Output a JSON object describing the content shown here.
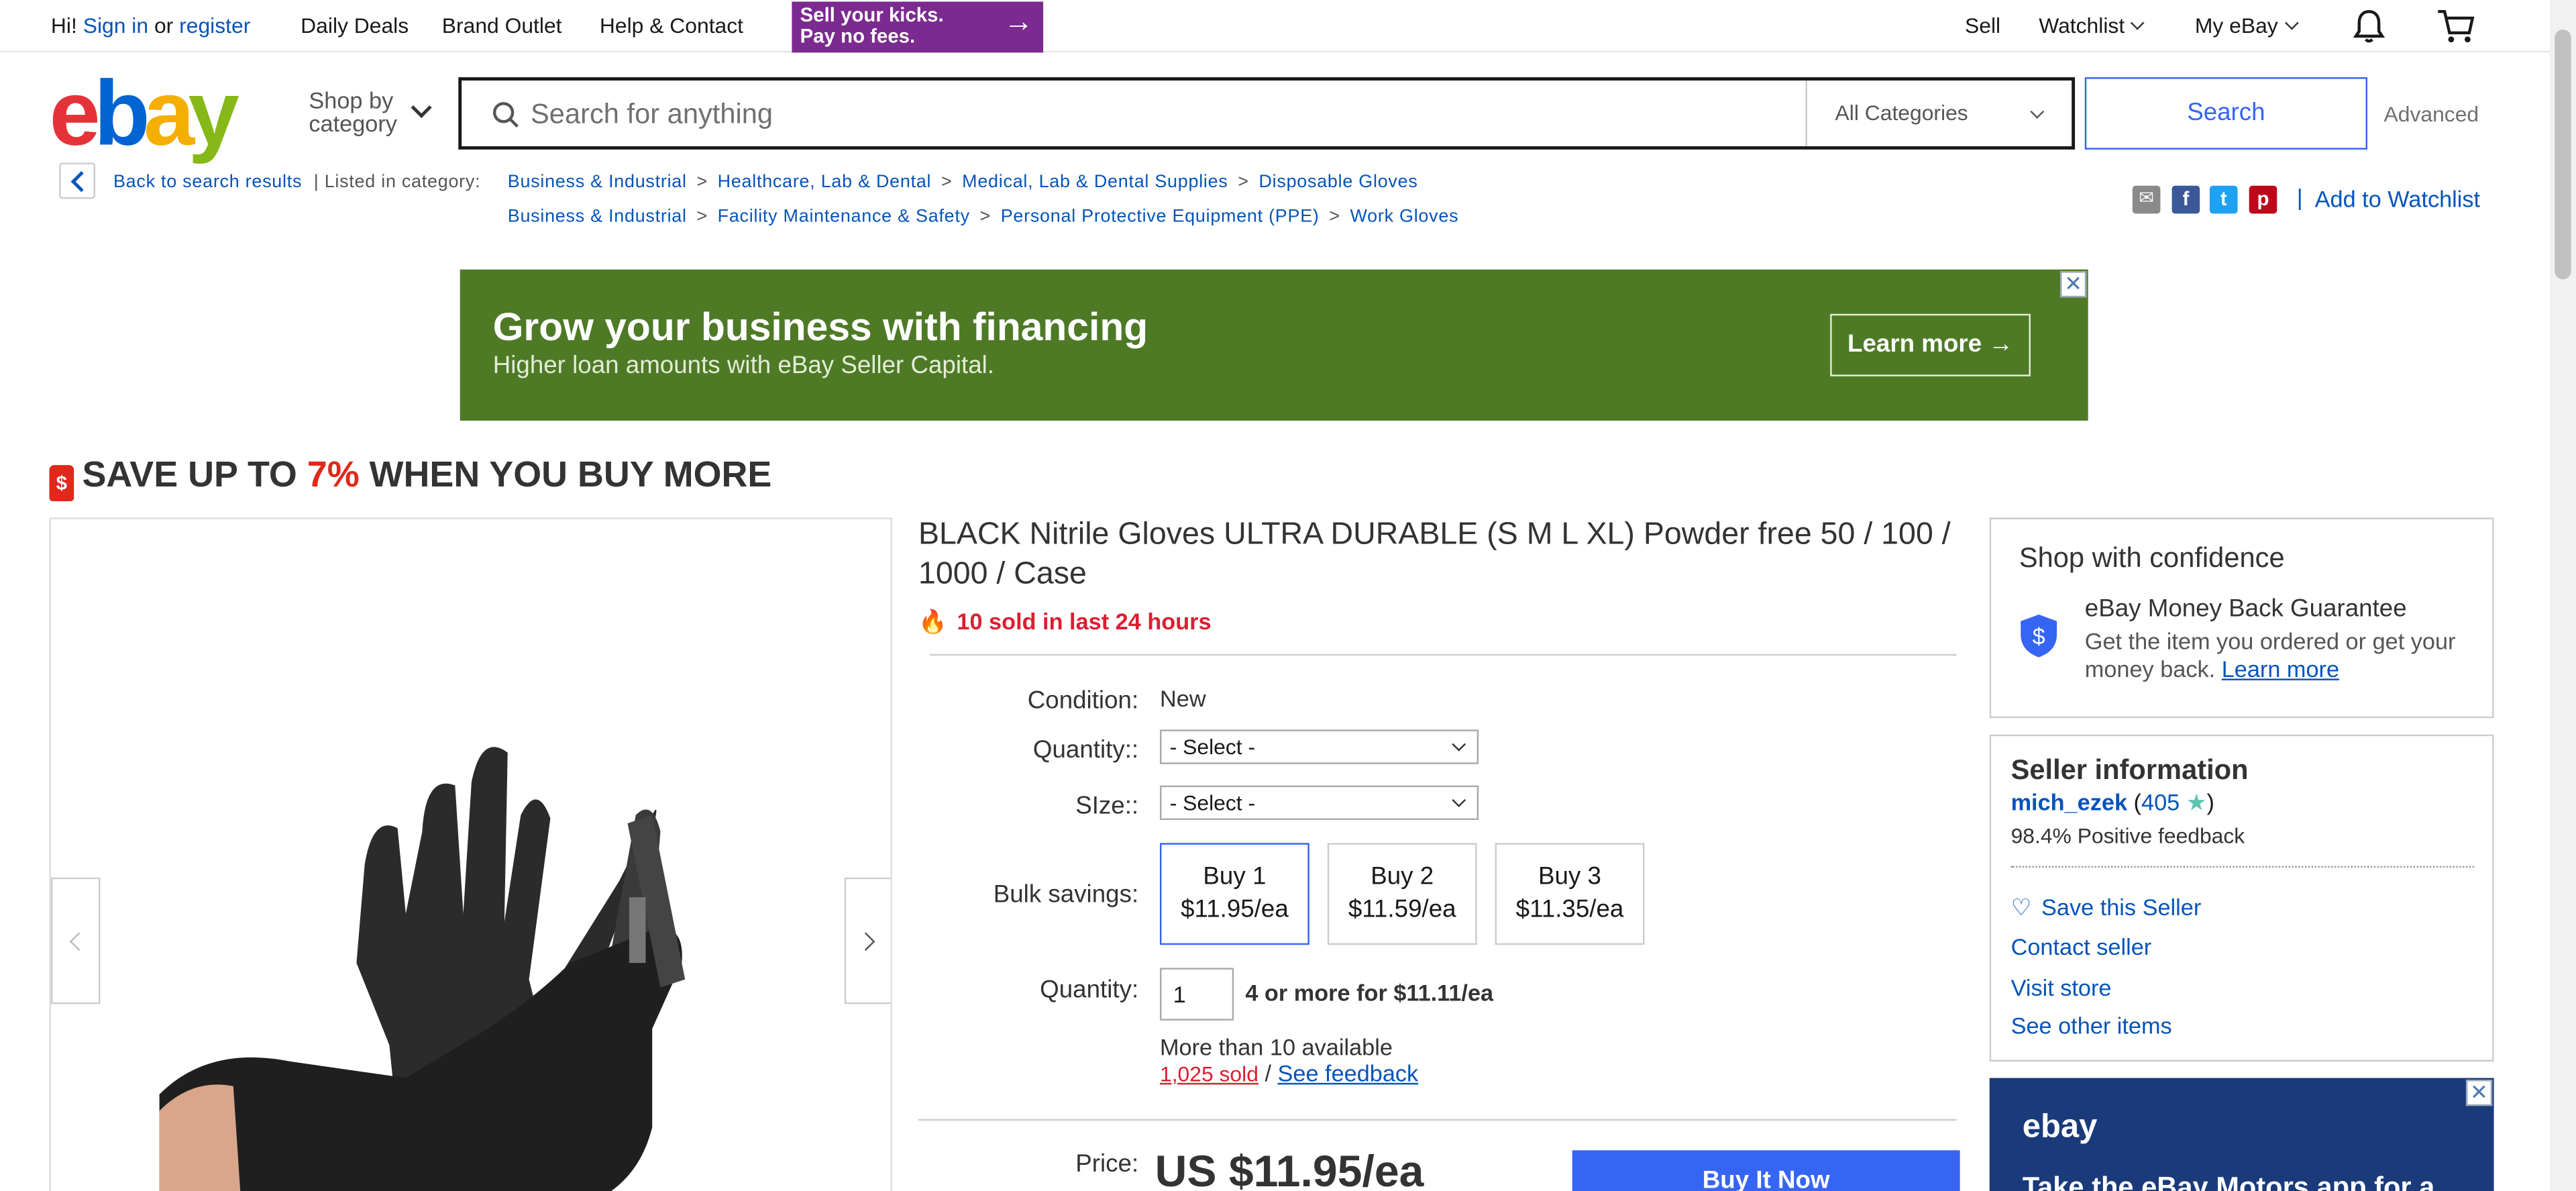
{
  "topnav": {
    "greeting": "Hi!",
    "sign_in": "Sign in",
    "or": "or",
    "register": "register",
    "daily_deals": "Daily Deals",
    "brand_outlet": "Brand Outlet",
    "help_contact": "Help & Contact",
    "banner_line1": "Sell your kicks.",
    "banner_line2": "Pay no fees.",
    "sell": "Sell",
    "watchlist": "Watchlist",
    "my_ebay": "My eBay"
  },
  "header": {
    "logo": {
      "e": "e",
      "b": "b",
      "a": "a",
      "y": "y"
    },
    "shop_by_line1": "Shop by",
    "shop_by_line2": "category",
    "search_placeholder": "Search for anything",
    "category_select": "All Categories",
    "search_button": "Search",
    "advanced": "Advanced"
  },
  "breadcrumb": {
    "back": "Back to search results",
    "listed_in": "| Listed in category:",
    "path1": [
      "Business & Industrial",
      "Healthcare, Lab & Dental",
      "Medical, Lab & Dental Supplies",
      "Disposable Gloves"
    ],
    "path2": [
      "Business & Industrial",
      "Facility Maintenance & Safety",
      "Personal Protective Equipment (PPE)",
      "Work Gloves"
    ],
    "separator": ">",
    "add_to_watchlist": "Add to Watchlist"
  },
  "ad": {
    "headline": "Grow your business with financing",
    "subline": "Higher loan amounts with eBay Seller Capital.",
    "button": "Learn more",
    "close": "✕",
    "bg": "#4e7a26"
  },
  "savebar": {
    "text1": "SAVE UP TO ",
    "percent": "7%",
    "text2": " WHEN YOU BUY MORE",
    "tag": "$"
  },
  "product": {
    "title": "BLACK Nitrile Gloves ULTRA DURABLE (S M L XL) Powder free 50 / 100 / 1000 / Case",
    "hot": "10 sold in last 24 hours",
    "condition_label": "Condition:",
    "condition_value": "New",
    "quantity_select_label": "Quantity::",
    "size_label": "SIze::",
    "select_default": "- Select -",
    "bulk_label": "Bulk savings:",
    "bulk": [
      {
        "qty": "Buy 1",
        "price": "$11.95/ea"
      },
      {
        "qty": "Buy 2",
        "price": "$11.59/ea"
      },
      {
        "qty": "Buy 3",
        "price": "$11.35/ea"
      }
    ],
    "quantity_label": "Quantity:",
    "quantity_value": "1",
    "quantity_note": "4 or more for $11.11/ea",
    "available": "More than 10 available",
    "sold": "1,025 sold",
    "slash": "/",
    "see_feedback": "See feedback",
    "price_label": "Price:",
    "price": "US $11.95/ea",
    "buy_now": "Buy It Now"
  },
  "confidence": {
    "title": "Shop with confidence",
    "guarantee": "eBay Money Back Guarantee",
    "desc": "Get the item you ordered or get your money back.",
    "learn_more": "Learn more"
  },
  "seller": {
    "title": "Seller information",
    "name": "mich_ezek",
    "score": "405",
    "feedback": "98.4% Positive feedback",
    "save": "Save this Seller",
    "contact": "Contact seller",
    "visit": "Visit store",
    "other": "See other items"
  },
  "ad2": {
    "logo": "ebay",
    "text": "Take the eBay Motors app for a"
  },
  "colors": {
    "link": "#0654ba",
    "accent_blue": "#3665f3",
    "red": "#e0281b"
  }
}
